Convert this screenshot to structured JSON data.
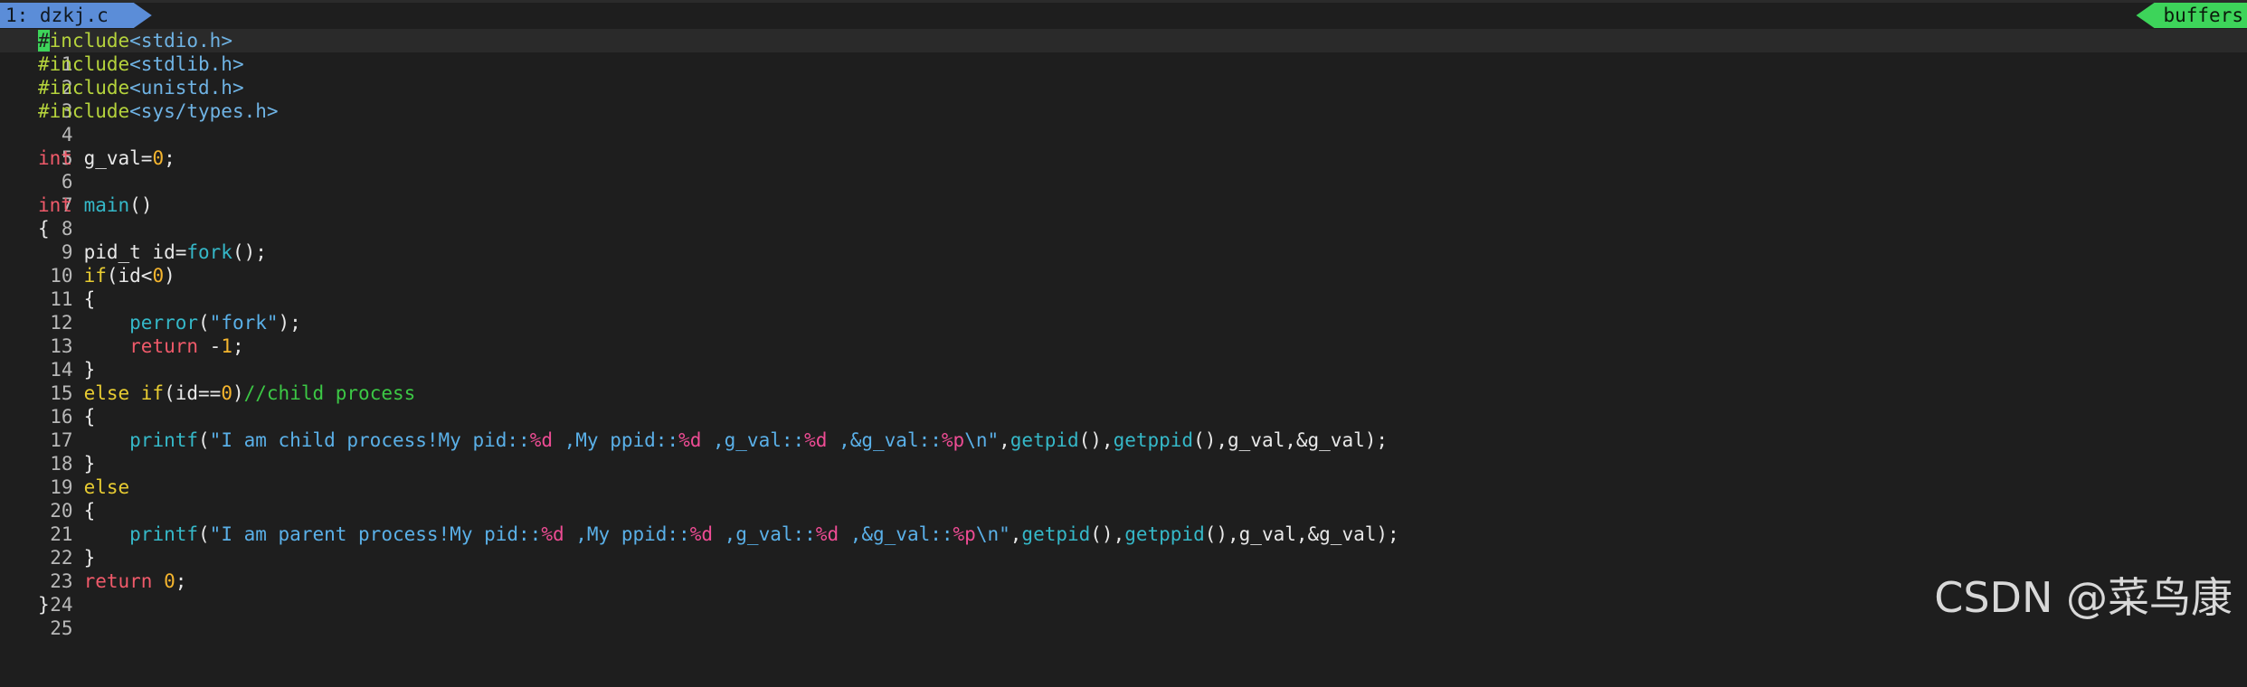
{
  "tabline": {
    "active_tab": "1: dzkj.c",
    "buffers_label": "buffers"
  },
  "editor": {
    "line_numbers": [
      "1",
      "2",
      "3",
      "4",
      "5",
      "6",
      "7",
      "8",
      "9",
      "10",
      "11",
      "12",
      "13",
      "14",
      "15",
      "16",
      "17",
      "18",
      "19",
      "20",
      "21",
      "22",
      "23",
      "24",
      "25"
    ],
    "tokens": {
      "l1_cursor": "#",
      "l1_macro": "include",
      "l1_inc": "<stdio.h>",
      "l2_macro": "#include",
      "l2_inc": "<stdlib.h>",
      "l3_macro": "#include",
      "l3_inc": "<unistd.h>",
      "l4_macro": "#include",
      "l4_inc": "<sys/types.h>",
      "l6_type": "int",
      "l6_a": " g_val=",
      "l6_num": "0",
      "l6_b": ";",
      "l8_type": "int",
      "l8_sp": " ",
      "l8_func": "main",
      "l8_b": "()",
      "l9": "{",
      "l10_a": "    pid_t id=",
      "l10_func": "fork",
      "l10_b": "();",
      "l11_ind": "    ",
      "l11_kw": "if",
      "l11_a": "(id<",
      "l11_num": "0",
      "l11_b": ")",
      "l12": "    {",
      "l13_ind": "        ",
      "l13_func": "perror",
      "l13_a": "(",
      "l13_str": "\"fork\"",
      "l13_b": ");",
      "l14_ind": "        ",
      "l14_ret": "return",
      "l14_a": " -",
      "l14_num": "1",
      "l14_b": ";",
      "l15": "    }",
      "l16_ind": "    ",
      "l16_kw": "else if",
      "l16_a": "(id==",
      "l16_num": "0",
      "l16_b": ")",
      "l16_cmt": "//child process",
      "l17": "    {",
      "l18_ind": "        ",
      "l18_func": "printf",
      "l18_a": "(",
      "l18_s1": "\"I am child process!My pid::",
      "l18_f1": "%d",
      "l18_s2": " ,My ppid::",
      "l18_f2": "%d",
      "l18_s3": " ,g_val::",
      "l18_f3": "%d",
      "l18_s4": " ,&g_val::",
      "l18_f4": "%p",
      "l18_s5": "\\n\"",
      "l18_b": ",",
      "l18_fn2": "getpid",
      "l18_c": "(),",
      "l18_fn3": "getppid",
      "l18_d": "(),g_val,&g_val);",
      "l19": "    }",
      "l20_ind": "    ",
      "l20_kw": "else",
      "l21": "    {",
      "l22_ind": "        ",
      "l22_func": "printf",
      "l22_a": "(",
      "l22_s1": "\"I am parent process!My pid::",
      "l22_f1": "%d",
      "l22_s2": " ,My ppid::",
      "l22_f2": "%d",
      "l22_s3": " ,g_val::",
      "l22_f3": "%d",
      "l22_s4": " ,&g_val::",
      "l22_f4": "%p",
      "l22_s5": "\\n\"",
      "l22_b": ",",
      "l22_fn2": "getpid",
      "l22_c": "(),",
      "l22_fn3": "getppid",
      "l22_d": "(),g_val,&g_val);",
      "l23": "    }",
      "l24_ind": "    ",
      "l24_ret": "return",
      "l24_sp": " ",
      "l24_num": "0",
      "l24_b": ";",
      "l25": "}"
    }
  },
  "watermark": "CSDN @菜鸟康",
  "colors": {
    "background": "#1e1e1e",
    "tab_active": "#5b8dd8",
    "buffers_badge": "#3dd45a",
    "macro": "#b5d33c",
    "type": "#f05a6a",
    "number": "#f5b52e",
    "function": "#35b8c8",
    "string": "#5ab0e8",
    "format_specifier": "#ee4c94",
    "keyword": "#e8cc32",
    "comment": "#3cc845"
  }
}
